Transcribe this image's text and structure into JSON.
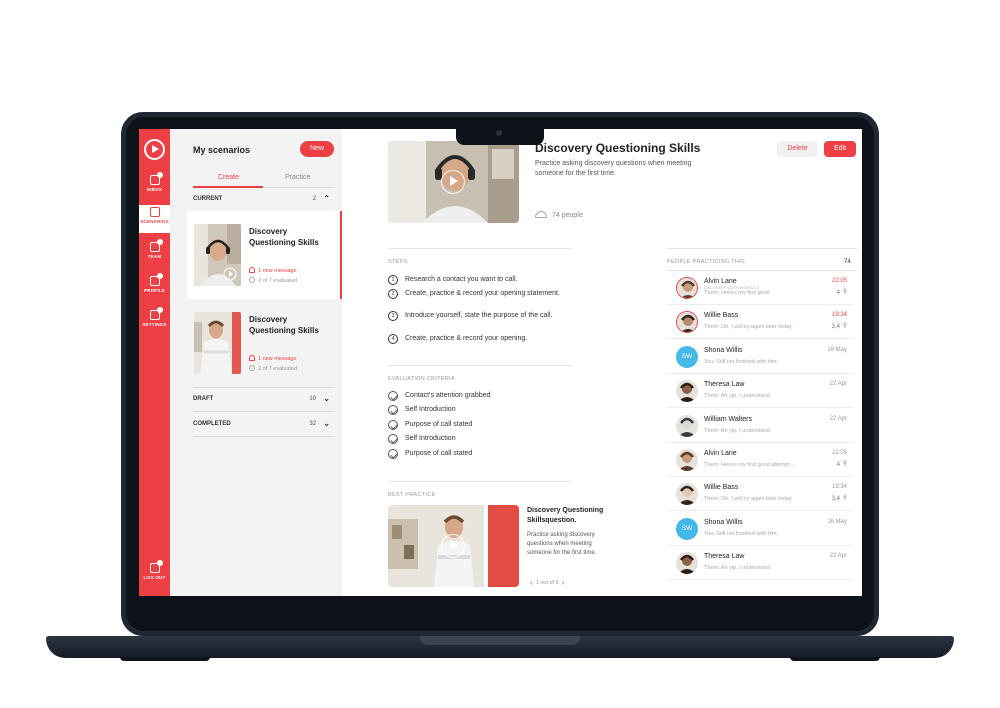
{
  "app": {
    "nav": [
      {
        "label": "INBOX",
        "icon": "inbox-icon",
        "active": false
      },
      {
        "label": "SCENARIOS",
        "icon": "scenarios-icon",
        "active": true
      },
      {
        "label": "TEAM",
        "icon": "team-icon",
        "active": false
      },
      {
        "label": "PROFILE",
        "icon": "profile-icon",
        "active": false
      },
      {
        "label": "SETTINGS",
        "icon": "settings-icon",
        "active": false
      },
      {
        "label": "LOG OUT",
        "icon": "logout-icon",
        "active": false
      }
    ]
  },
  "scenarios": {
    "title": "My scenarios",
    "new_label": "New",
    "tabs": [
      "Create",
      "Practice"
    ],
    "sections": {
      "current": {
        "label": "CURRENT",
        "count": "2"
      },
      "draft": {
        "label": "DRAFT",
        "count": "10"
      },
      "completed": {
        "label": "COMPLETED",
        "count": "32"
      }
    },
    "cards": [
      {
        "title": "Discovery Questioning Skills",
        "message": "1 new message",
        "evaluated": "2 of 7 evaluated"
      },
      {
        "title": "Discovery Questioning Skills",
        "message": "1 new message",
        "evaluated": "2 of 7 evaluated"
      }
    ]
  },
  "detail": {
    "title": "Discovery Questioning Skills",
    "description": "Practice asking discovery questions when meeting someone for the first time.",
    "people": "74 people",
    "delete_label": "Delete",
    "edit_label": "Edit",
    "steps_label": "STEPS",
    "steps": [
      {
        "num": "1",
        "text": "Research a contact you want to call."
      },
      {
        "num": "2",
        "text": "Create, practice & record your opening statement."
      },
      {
        "num": "3",
        "text": "Introduce yourself, state the purpose of the call."
      },
      {
        "num": "4",
        "text": "Create, practice & record your opening."
      }
    ],
    "criteria_label": "EVALUATION CRITERIA",
    "criteria": [
      "Contact's attention grabbed",
      "Self Introduction",
      "Purpose of call stated",
      "Self Introduction",
      "Purpose of call stated"
    ],
    "best_practice": {
      "label": "BEST PRACTICE",
      "title": "Discovery Questioning Skillsquestion.",
      "description": "Practice asking discovery questions when meeting someone for the first time.",
      "pager": "1 out of 5"
    }
  },
  "people_panel": {
    "label": "PEOPLE PRACTICING THIS",
    "count": "74",
    "people": [
      {
        "name": "Alvin Lane",
        "sub": "DISCOVERY QUSTION SKILLS",
        "message": "Them: Here's my first good",
        "time": "22:05",
        "score": "4",
        "ring": true,
        "initials": ""
      },
      {
        "name": "Willie Bass",
        "sub": "",
        "message": "Them: Ok, I will try again later today.",
        "time": "19:34",
        "score": "3,4",
        "ring": true,
        "initials": ""
      },
      {
        "name": "Shona Willis",
        "sub": "",
        "message": "You: Still not finished with him.",
        "time": "16 May",
        "score": "",
        "ring": false,
        "initials": "SW"
      },
      {
        "name": "Theresa Law",
        "sub": "",
        "message": "Them: Ah yip, I understand.",
        "time": "22 Apr",
        "score": "",
        "ring": false,
        "initials": ""
      },
      {
        "name": "William Walters",
        "sub": "",
        "message": "Them: Ah yip, I understand.",
        "time": "22 Apr",
        "score": "",
        "ring": false,
        "initials": ""
      },
      {
        "name": "Alvin Lane",
        "sub": "",
        "message": "Them: Here's my first good attempt...",
        "time": "22:05",
        "score": "4",
        "ring": false,
        "initials": ""
      },
      {
        "name": "Willie Bass",
        "sub": "",
        "message": "Them: Ok, I will try again later today.",
        "time": "19:34",
        "score": "3,4",
        "ring": false,
        "initials": ""
      },
      {
        "name": "Shona Willis",
        "sub": "",
        "message": "You: Still not finished with him.",
        "time": "16 May",
        "score": "",
        "ring": false,
        "initials": "SW"
      },
      {
        "name": "Theresa Law",
        "sub": "",
        "message": "Them: Ah yip, I understand.",
        "time": "22 Apr",
        "score": "",
        "ring": false,
        "initials": ""
      }
    ]
  },
  "colors": {
    "accent": "#ee3f45",
    "sidebar": "#ee3f45",
    "panel": "#f3f3f4",
    "avatar_initials_bg": "#45b8ea"
  }
}
